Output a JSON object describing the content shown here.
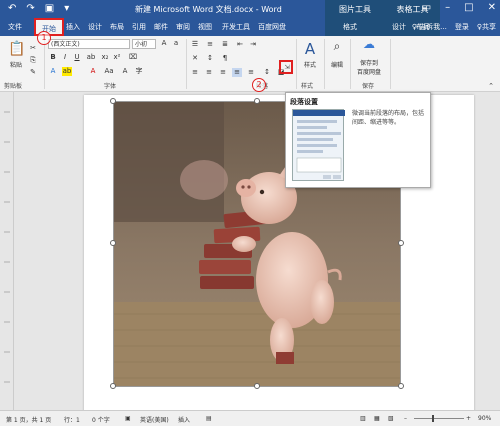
{
  "titlebar": {
    "doc_title": "新建 Microsoft Word 文档.docx - Word",
    "context_tab_1": "图片工具",
    "context_tab_2": "表格工具"
  },
  "tabs": {
    "file": "文件",
    "home": "开始",
    "insert": "插入",
    "design": "设计",
    "layout": "布局",
    "references": "引用",
    "mailings": "邮件",
    "review": "审阅",
    "view": "视图",
    "developer": "开发工具",
    "baidu": "百度网盘",
    "format": "格式",
    "table_design": "设计",
    "table_layout": "布局",
    "tell_me": "♀ 告诉我...",
    "login": "登录",
    "share": "♀共享"
  },
  "ribbon": {
    "paste_label": "粘贴",
    "font_name": "(西文正文)",
    "font_size": "小初",
    "style_label": "样式",
    "edit_label": "编辑",
    "save_baidu_label_1": "保存到",
    "save_baidu_label_2": "百度网盘",
    "group_clipboard": "剪贴板",
    "group_font": "字体",
    "group_paragraph": "段落",
    "group_style": "样式",
    "group_save": "保存"
  },
  "callouts": {
    "one": "1",
    "two": "2"
  },
  "tooltip": {
    "title": "段落设置",
    "description": "微调当前段落的布局，包括间距、缩进等等。"
  },
  "statusbar": {
    "page": "第 1 页，共 1 页",
    "line": "行：1",
    "words": "0 个字",
    "language": "英语(美国)",
    "mode": "插入",
    "zoom": "90%"
  },
  "colors": {
    "word_blue": "#2b579a",
    "highlight_red": "#e02020"
  }
}
